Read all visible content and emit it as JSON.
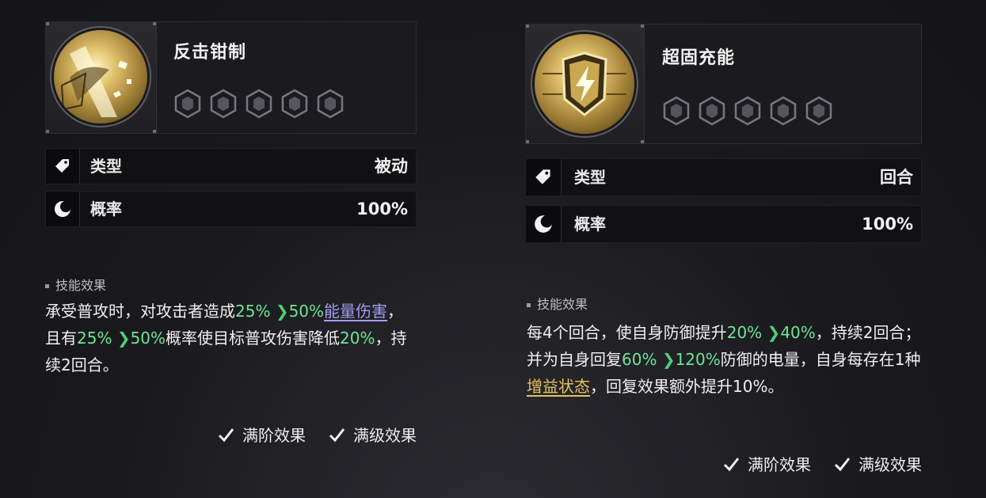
{
  "cards": [
    {
      "name": "反击钳制",
      "type_label": "类型",
      "type_value": "被动",
      "rate_label": "概率",
      "rate_value": "100%",
      "effect_heading": "技能效果",
      "effect": {
        "p1": "承受普攻时，对攻击者造成",
        "v1a": "25%",
        "v1b": "50%",
        "link": "能量伤害",
        "p2": "，且有",
        "v2a": "25%",
        "v2b": "50%",
        "p3": "概率使目标普攻伤害降低",
        "v3": "20%",
        "p4": "，持续2回合。"
      },
      "check1": "满阶效果",
      "check2": "满级效果",
      "level_pips": 5
    },
    {
      "name": "超固充能",
      "type_label": "类型",
      "type_value": "回合",
      "rate_label": "概率",
      "rate_value": "100%",
      "effect_heading": "技能效果",
      "effect": {
        "p1": "每4个回合，使自身防御提升",
        "v1a": "20%",
        "v1b": "40%",
        "p2": "，持续2回合；并为自身回复",
        "v2a": "60%",
        "v2b": "120%",
        "p3": "防御的电量，自身每存在1种",
        "link": "增益状态",
        "p4": "，回复效果额外提升10%。"
      },
      "check1": "满阶效果",
      "check2": "满级效果",
      "level_pips": 5
    }
  ],
  "colors": {
    "accent_green": "#6ee596",
    "link_blue": "#a79cf2",
    "link_gold": "#e7c25c"
  },
  "icons": [
    "tag-icon",
    "moon-icon",
    "hexagon-pip-icon",
    "checkmark-icon"
  ]
}
